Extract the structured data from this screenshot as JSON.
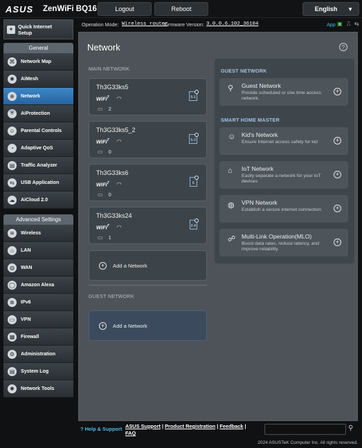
{
  "header": {
    "brand": "ASUS",
    "model": "ZenWiFi BQ16",
    "logout_label": "Logout",
    "reboot_label": "Reboot",
    "language": "English"
  },
  "status_bar": {
    "operation_mode_label": "Operation Mode:",
    "operation_mode_value": "Wireless router",
    "firmware_label": "Firmware Version:",
    "firmware_value": "3.0.0.6.102_36104",
    "app_label": "App"
  },
  "sidebar": {
    "quick_setup": "Quick Internet\nSetup",
    "general_header": "General",
    "general_items": [
      {
        "label": "Network Map",
        "icon": "network-map-icon"
      },
      {
        "label": "AiMesh",
        "icon": "aimesh-icon"
      },
      {
        "label": "Network",
        "icon": "network-icon",
        "active": true
      },
      {
        "label": "AiProtection",
        "icon": "shield-icon"
      },
      {
        "label": "Parental Controls",
        "icon": "parental-icon"
      },
      {
        "label": "Adaptive QoS",
        "icon": "gauge-icon"
      },
      {
        "label": "Traffic Analyzer",
        "icon": "chart-icon"
      },
      {
        "label": "USB Application",
        "icon": "usb-icon"
      },
      {
        "label": "AiCloud 2.0",
        "icon": "cloud-icon"
      }
    ],
    "advanced_header": "Advanced Settings",
    "advanced_items": [
      {
        "label": "Wireless",
        "icon": "wifi-icon"
      },
      {
        "label": "LAN",
        "icon": "lan-icon"
      },
      {
        "label": "WAN",
        "icon": "globe-icon"
      },
      {
        "label": "Amazon Alexa",
        "icon": "alexa-icon"
      },
      {
        "label": "IPv6",
        "icon": "ipv6-icon"
      },
      {
        "label": "VPN",
        "icon": "vpn-icon"
      },
      {
        "label": "Firewall",
        "icon": "firewall-icon"
      },
      {
        "label": "Administration",
        "icon": "admin-icon"
      },
      {
        "label": "System Log",
        "icon": "log-icon"
      },
      {
        "label": "Network Tools",
        "icon": "tools-icon"
      }
    ]
  },
  "main": {
    "title": "Network",
    "main_network_header": "MAIN NETWORK",
    "networks": [
      {
        "ssid": "Th3G33ks5",
        "band": "5-1",
        "clients": "2"
      },
      {
        "ssid": "Th3G33ks5_2",
        "band": "5-2",
        "clients": "0"
      },
      {
        "ssid": "Th3G33ks6",
        "band": "6",
        "clients": "0"
      },
      {
        "ssid": "Th3G33ks24",
        "band": "2.4",
        "clients": "1"
      }
    ],
    "wifi_badge": "WiFi",
    "wifi_badge_num": "7",
    "add_network": "Add a Network",
    "guest_network_header": "GUEST NETWORK",
    "add_guest_network": "Add a Network"
  },
  "right_panel": {
    "guest_header": "GUEST NETWORK",
    "guest": {
      "title": "Guest Network",
      "desc": "Provide scheduled or one time access network."
    },
    "smart_header": "SMART HOME MASTER",
    "smart_items": [
      {
        "title": "Kid's Network",
        "desc": "Ensure Internet access safety for kid",
        "icon": "kid-icon"
      },
      {
        "title": "IoT Network",
        "desc": "Easily separate a network for your IoT devices",
        "icon": "iot-icon"
      },
      {
        "title": "VPN Network",
        "desc": "Establish a secure internet connection",
        "icon": "vpn-globe-icon"
      },
      {
        "title": "Multi-Link Operation(MLO)",
        "desc": "Boost data rates, reduce latency, and improve reliability.",
        "icon": "mlo-icon"
      }
    ]
  },
  "footer": {
    "help_support": "Help & Support",
    "asus_support": "ASUS Support",
    "product_registration": "Product Registration",
    "feedback": "Feedback",
    "faq": "FAQ",
    "copyright": "2024 ASUSTeK Computer Inc. All rights reserved."
  }
}
